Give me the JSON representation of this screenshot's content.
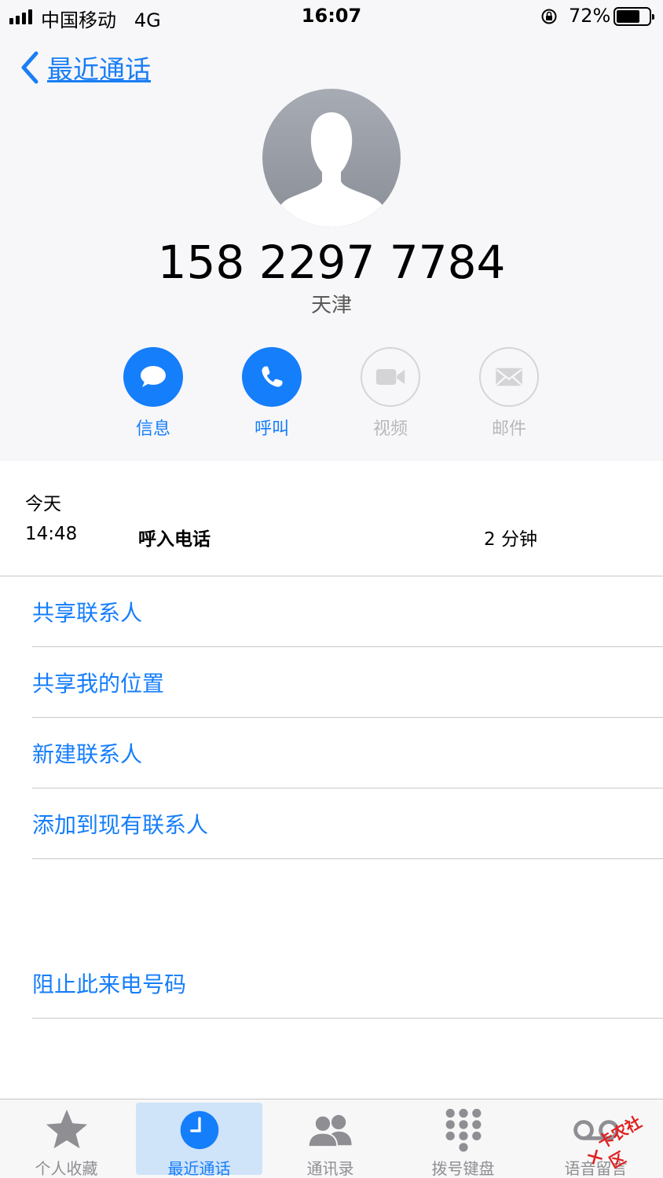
{
  "status_bar": {
    "carrier": "中国移动",
    "network": "4G",
    "time": "16:07",
    "battery_percent": "72%",
    "battery_level": 0.72,
    "signal_bars": 4
  },
  "nav": {
    "back_label": "最近通话"
  },
  "contact": {
    "phone_number": "158 2297 7784",
    "location": "天津"
  },
  "actions": [
    {
      "label": "信息",
      "icon": "message-icon",
      "enabled": true
    },
    {
      "label": "呼叫",
      "icon": "phone-icon",
      "enabled": true
    },
    {
      "label": "视频",
      "icon": "video-icon",
      "enabled": false
    },
    {
      "label": "邮件",
      "icon": "mail-icon",
      "enabled": false
    }
  ],
  "history": {
    "date": "今天",
    "entries": [
      {
        "time": "14:48",
        "type": "呼入电话",
        "duration": "2 分钟"
      }
    ]
  },
  "options": [
    "共享联系人",
    "共享我的位置",
    "新建联系人",
    "添加到现有联系人"
  ],
  "block_option": "阻止此来电号码",
  "tabbar": {
    "active_index": 1,
    "tabs": [
      {
        "label": "个人收藏",
        "icon": "star-icon"
      },
      {
        "label": "最近通话",
        "icon": "clock-icon"
      },
      {
        "label": "通讯录",
        "icon": "contacts-icon"
      },
      {
        "label": "拨号键盘",
        "icon": "keypad-icon"
      },
      {
        "label": "语音留言",
        "icon": "voicemail-icon"
      }
    ]
  },
  "watermark": {
    "mark": "✕",
    "text": "卡农社区"
  },
  "colors": {
    "accent": "#157efb",
    "disabled": "#b8b8bc",
    "header_bg": "#f7f7f9",
    "separator": "#c8c8cc",
    "tab_highlight": "#cfe3f9"
  }
}
